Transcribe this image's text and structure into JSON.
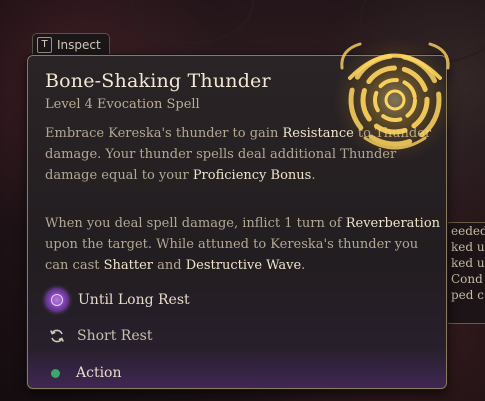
{
  "inspect": {
    "key": "T",
    "label": "Inspect"
  },
  "spell": {
    "name": "Bone-Shaking Thunder",
    "subtitle": "Level 4 Evocation Spell",
    "icon": "thunder-rings-icon",
    "description1": {
      "p1": "Embrace Kereska's thunder to gain ",
      "k1": "Resistance",
      "p2": " to Thunder damage. Your thunder spells deal additional Thunder damage equal to your ",
      "k2": "Proficiency Bonus",
      "p3": "."
    },
    "description2": {
      "p1": "When you deal spell damage, inflict 1 turn of ",
      "k1": "Reverberation",
      "p2": " upon the target. While attuned to Kereska's thunder you can cast ",
      "k2": "Shatter",
      "p3": " and ",
      "k3": "Destructive Wave",
      "p4": "."
    },
    "duration": "Until Long Rest",
    "recharge": "Short Rest",
    "cost": "Action"
  },
  "background_panel": {
    "lines": [
      "eeded",
      "ked u",
      "ked u",
      "Cond",
      "ped c"
    ]
  },
  "colors": {
    "accent_gold": "#f0c040",
    "keyword": "#f0e4cd",
    "action_dot": "#3fa66a",
    "duration_purple": "#8a4cc0"
  }
}
